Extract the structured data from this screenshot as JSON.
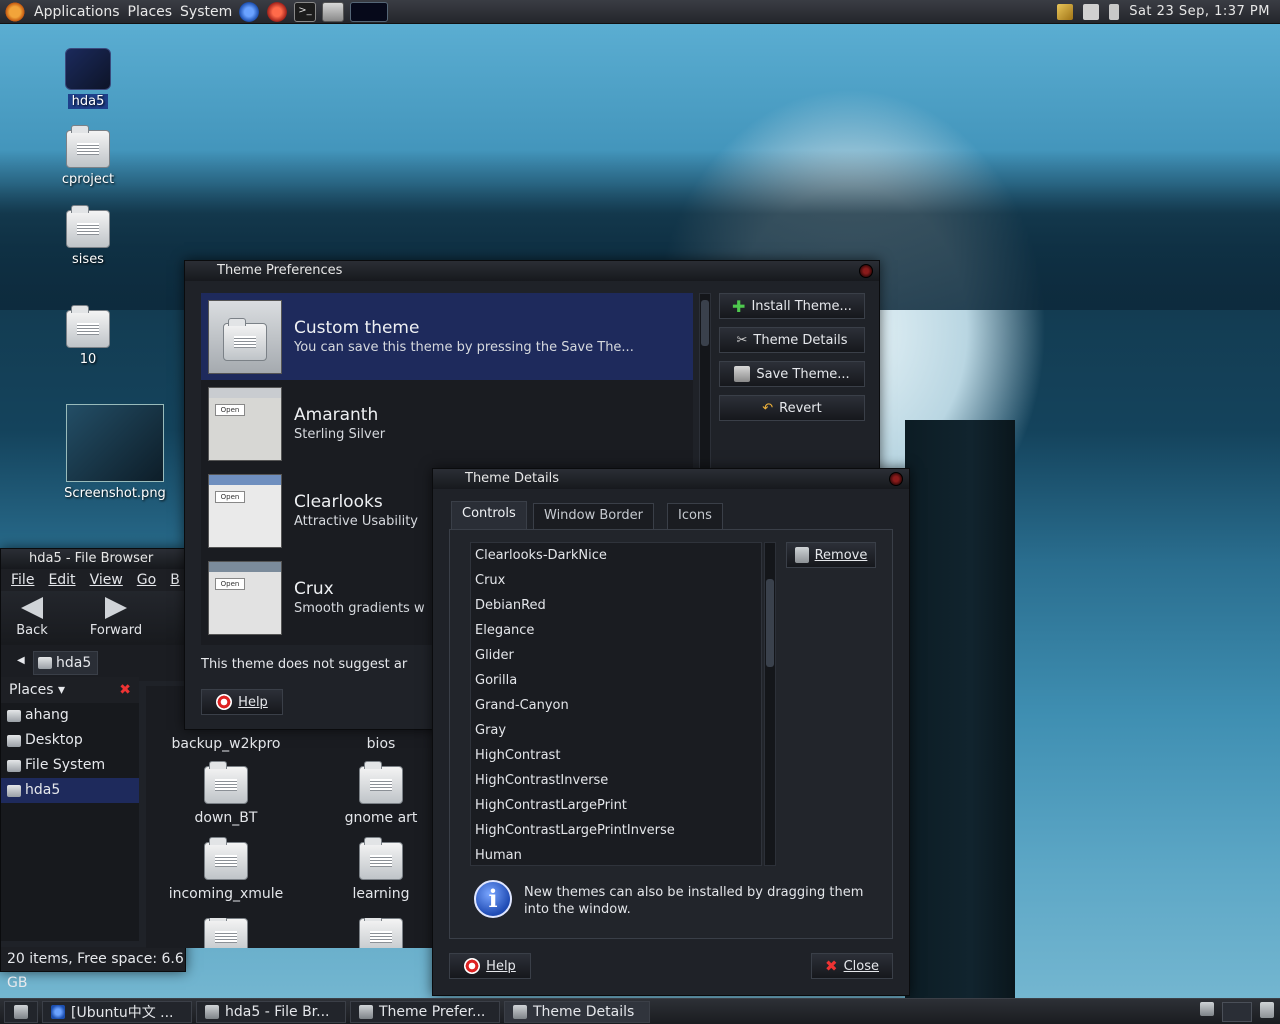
{
  "top_panel": {
    "menus": [
      "Applications",
      "Places",
      "System"
    ],
    "clock": "Sat 23 Sep,  1:37 PM",
    "terminal_glyph": ">_"
  },
  "desktop": {
    "icons": [
      {
        "label": "hda5",
        "kind": "drive"
      },
      {
        "label": "cproject",
        "kind": "folder"
      },
      {
        "label": "sises",
        "kind": "folder"
      },
      {
        "label": "10",
        "kind": "folder"
      },
      {
        "label": "Screenshot.png",
        "kind": "image"
      }
    ]
  },
  "theme_prefs": {
    "title": "Theme Preferences",
    "themes": [
      {
        "name": "Custom theme",
        "desc": "You can save this theme by pressing the Save The..."
      },
      {
        "name": "Amaranth",
        "desc": "Sterling Silver"
      },
      {
        "name": "Clearlooks",
        "desc": "Attractive Usability"
      },
      {
        "name": "Crux",
        "desc": "Smooth gradients w"
      }
    ],
    "preview_button": "Open",
    "buttons": {
      "install": "Install Theme...",
      "details": "Theme Details",
      "save": "Save Theme...",
      "revert": "Revert"
    },
    "note": "This theme does not suggest ar",
    "help": "Help"
  },
  "theme_details": {
    "title": "Theme Details",
    "tabs": [
      "Controls",
      "Window Border",
      "Icons"
    ],
    "list": [
      "Clearlooks-DarkNice",
      "Crux",
      "DebianRed",
      "Elegance",
      "Glider",
      "Gorilla",
      "Grand-Canyon",
      "Gray",
      "HighContrast",
      "HighContrastInverse",
      "HighContrastLargePrint",
      "HighContrastLargePrintInverse",
      "Human"
    ],
    "remove": "Remove",
    "info": "New themes can also be installed by dragging them into the window.",
    "help": "Help",
    "close": "Close",
    "info_glyph": "i"
  },
  "file_browser": {
    "title": "hda5 - File Browser",
    "menus": [
      "File",
      "Edit",
      "View",
      "Go",
      "B"
    ],
    "back": "Back",
    "forward": "Forward",
    "location": "hda5",
    "places_label": "Places",
    "places": [
      "ahang",
      "Desktop",
      "File System",
      "hda5"
    ],
    "files": [
      "backup_w2kpro",
      "bios",
      "down_BT",
      "gnome art",
      "incoming_xmule",
      "learning"
    ],
    "status": "20 items, Free space: 6.6 GB"
  },
  "taskbar": {
    "tasks": [
      "[Ubuntu中文 ...",
      "hda5 - File Br...",
      "Theme Prefer...",
      "Theme Details"
    ]
  },
  "colors": {
    "selection": "#1e2a5c",
    "window_bg": "#1f2228",
    "accent_green": "#4ec94e",
    "danger": "#ee3333"
  }
}
